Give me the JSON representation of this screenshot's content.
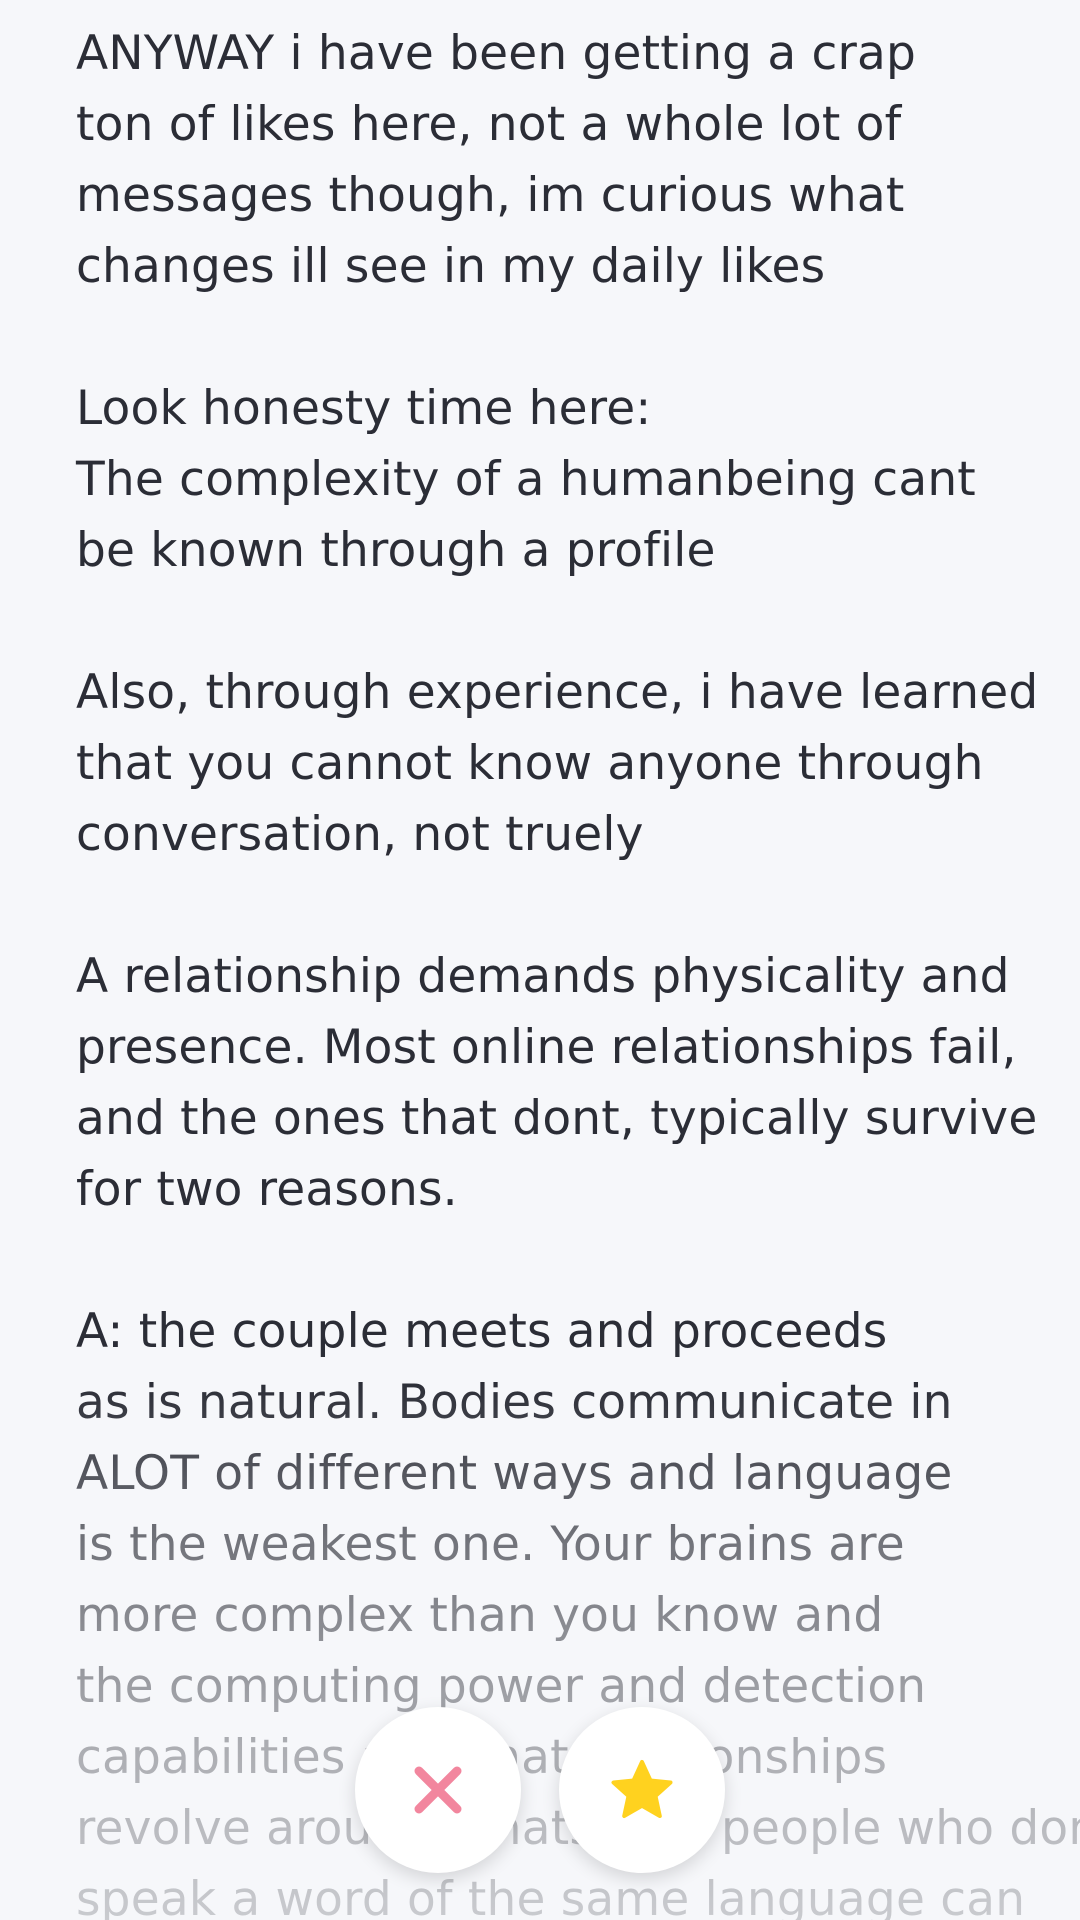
{
  "essay": {
    "paragraphs": [
      {
        "lines": [
          "ANYWAY i have been getting a crap",
          "ton of likes here, not a whole lot of",
          "messages though, im curious what",
          "changes ill see in my daily likes"
        ]
      },
      {
        "lines": [
          "Look honesty time here:",
          "The complexity of a humanbeing cant",
          "be known through a profile"
        ]
      },
      {
        "lines": [
          "Also, through experience, i have learned",
          "that you cannot know anyone through",
          "conversation, not truely"
        ]
      },
      {
        "lines": [
          "A relationship demands physicality and",
          "presence. Most online relationships fail,",
          "and the ones that dont, typically survive",
          "for two reasons."
        ]
      },
      {
        "lines": [
          "A: the couple meets and proceeds",
          "as is natural. Bodies communicate in",
          "ALOT of different ways and language",
          "is the weakest one. Your brains are",
          "more complex than you know and",
          "the computing power and detection",
          "capabilities are what relationships",
          "revolve around. Thats why people who dont",
          "speak a word of the same language can"
        ]
      }
    ]
  },
  "actions": {
    "pass": {
      "icon": "close-icon",
      "color": "#f2869e"
    },
    "superlike": {
      "icon": "star-icon",
      "color": "#ffd21f"
    }
  },
  "colors": {
    "background": "#f6f7fa",
    "text": "#2b2d36"
  }
}
